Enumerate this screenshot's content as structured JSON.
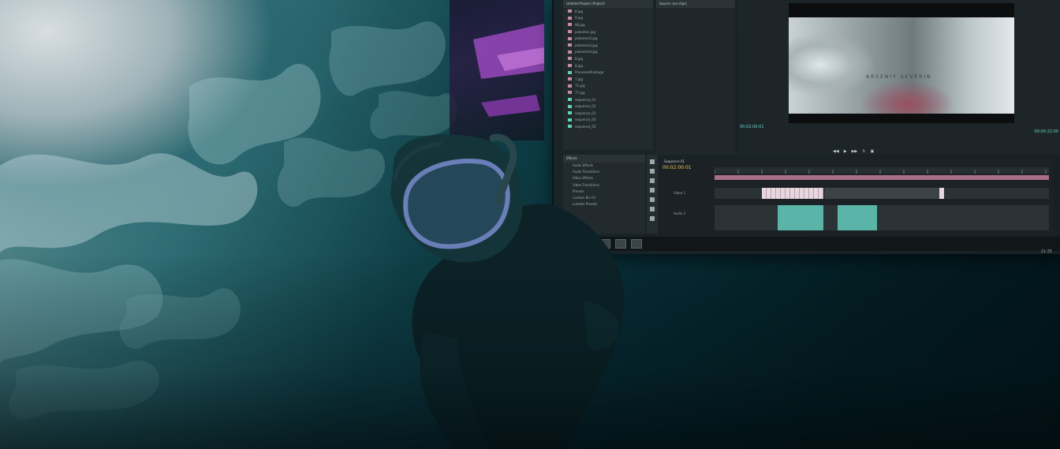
{
  "project_panel": {
    "header": "Untitled Project (Project)",
    "items": [
      {
        "name": "8.jpg",
        "color": "#c58ca0"
      },
      {
        "name": "9.jpg",
        "color": "#c58ca0"
      },
      {
        "name": "88.jpg",
        "color": "#c58ca0"
      },
      {
        "name": "pokemon.jpg",
        "color": "#c58ca0"
      },
      {
        "name": "pokemon2.jpg",
        "color": "#c58ca0"
      },
      {
        "name": "pokemon3.jpg",
        "color": "#c58ca0"
      },
      {
        "name": "pokemon4.jpg",
        "color": "#c58ca0"
      },
      {
        "name": "8.jpg",
        "color": "#c58ca0"
      },
      {
        "name": "8.jpg",
        "color": "#c58ca0"
      },
      {
        "name": "ProcessedFootage",
        "color": "#5fd3a8"
      },
      {
        "name": "7.jpg",
        "color": "#c58ca0"
      },
      {
        "name": "71.jpg",
        "color": "#c58ca0"
      },
      {
        "name": "77.jpg",
        "color": "#c58ca0"
      },
      {
        "name": "sequence_01",
        "color": "#5fd3a8"
      },
      {
        "name": "sequence_02",
        "color": "#5fd3a8"
      },
      {
        "name": "sequence_03",
        "color": "#5fd3a8"
      },
      {
        "name": "sequence_04",
        "color": "#5fd3a8"
      },
      {
        "name": "sequence_05",
        "color": "#5fd3a8"
      }
    ]
  },
  "effects_panel": {
    "tab": "Effects",
    "items": [
      "Audio Effects",
      "Audio Transitions",
      "Video Effects",
      "Video Transitions",
      "Presets",
      "Custom Bin 01",
      "Lumetri Presets"
    ]
  },
  "source_panel": {
    "header": "Source: (no clips)"
  },
  "program_monitor": {
    "frame_title": "ARSENIY SEVERIN",
    "timecode_left": "00:02:00:01",
    "timecode_right": "00:00:22:00"
  },
  "timeline": {
    "tab": "Sequence 01",
    "timecode": "00:02:00:01",
    "tracks": [
      {
        "label": "Video 1"
      },
      {
        "label": "Audio 1"
      }
    ]
  },
  "taskbar": {
    "clock": "21:35"
  },
  "colors": {
    "clip_pink": "#d98aa8",
    "clip_teal": "#66d6c6",
    "timecode_accent": "#e6c35a"
  }
}
